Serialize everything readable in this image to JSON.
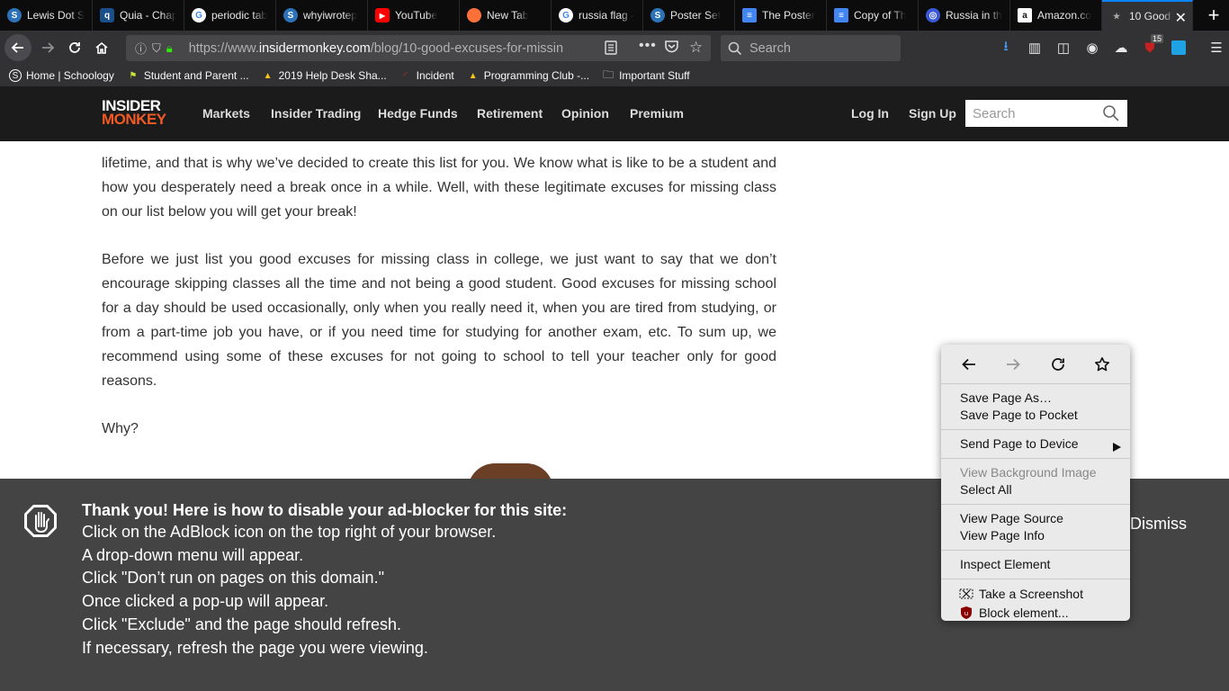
{
  "browser": {
    "tabs": [
      {
        "title": "Lewis Dot S",
        "icon": "schoology-icon",
        "color": "#2b72b9"
      },
      {
        "title": "Quia - Chap",
        "icon": "quia-icon",
        "color": "#1b4f8a"
      },
      {
        "title": "periodic tab",
        "icon": "google-icon",
        "color": "#ffffff"
      },
      {
        "title": "whyiwrotep",
        "icon": "schoology-icon",
        "color": "#2b72b9"
      },
      {
        "title": "YouTube",
        "icon": "youtube-icon",
        "color": "#ff0000"
      },
      {
        "title": "New Tab",
        "icon": "firefox-icon",
        "color": "#ff7139"
      },
      {
        "title": "russia flag -",
        "icon": "google-icon",
        "color": "#ffffff"
      },
      {
        "title": "Poster Set",
        "icon": "schoology-icon",
        "color": "#2b72b9"
      },
      {
        "title": "The Poster",
        "icon": "docs-icon",
        "color": "#4285f4"
      },
      {
        "title": "Copy of Th",
        "icon": "docs-icon",
        "color": "#4285f4"
      },
      {
        "title": "Russia in th",
        "icon": "globe-icon",
        "color": "#3a58d8"
      },
      {
        "title": "Amazon.co",
        "icon": "amazon-icon",
        "color": "#ffffff"
      },
      {
        "title": "10 Good",
        "icon": "insidermonkey-icon",
        "color": "#333333",
        "active": true
      }
    ],
    "new_tab_label": "+",
    "url_prefix": "https://www.",
    "url_domain": "insidermonkey.com",
    "url_path": "/blog/10-good-excuses-for-missin",
    "search_placeholder": "Search",
    "ublock_badge": "15",
    "bookmarks": [
      {
        "label": "Home | Schoology",
        "icon": "schoology-icon"
      },
      {
        "label": "Student and Parent ...",
        "icon": "flag-icon"
      },
      {
        "label": "2019 Help Desk Sha...",
        "icon": "drive-icon"
      },
      {
        "label": "Incident",
        "icon": "incident-icon"
      },
      {
        "label": "Programming Club -...",
        "icon": "drive-icon"
      },
      {
        "label": "Important Stuff",
        "icon": "folder-icon"
      }
    ]
  },
  "site": {
    "logo_top": "INSIDER",
    "logo_bottom": "MONKEY",
    "nav": [
      "Markets",
      "Insider Trading",
      "Hedge Funds",
      "Retirement",
      "Opinion",
      "Premium"
    ],
    "login": "Log In",
    "signup": "Sign Up",
    "search_placeholder": "Search"
  },
  "article": {
    "p1": "lifetime, and that is why we’ve decided to create this list for you. We know what is like to be a student and how you desperately need a break once in a while. Well, with these legitimate excuses for missing class on our list below you will get your break!",
    "p2": "Before we just list you good excuses for missing class in college, we just want to say that we don’t encourage skipping classes all the time and not being a good student. Good excuses for missing school for a day should be used occasionally, only when you really need it, when you are tired from studying, or from a part-time job you have, or if you need time for studying for another exam, etc. To sum up, we recommend using some of these excuses for not going to school to tell your teacher only for good reasons.",
    "p3": "Why?"
  },
  "adblock": {
    "title": "Thank you! Here is how to disable your ad-blocker for this site:",
    "lines": [
      "Click on the AdBlock icon on the top right of your browser.",
      "A drop-down menu will appear.",
      "Click \"Don’t run on pages on this domain.\"",
      "Once clicked a pop-up will appear.",
      "Click \"Exclude\" and the page should refresh.",
      "If necessary, refresh the page you were viewing."
    ],
    "dismiss": "Dismiss"
  },
  "context_menu": {
    "save_page_as": "Save Page As…",
    "save_to_pocket": "Save Page to Pocket",
    "send_to_device": "Send Page to Device",
    "view_bg_image": "View Background Image",
    "select_all": "Select All",
    "view_source": "View Page Source",
    "view_info": "View Page Info",
    "inspect": "Inspect Element",
    "screenshot": "Take a Screenshot",
    "block_element": "Block element..."
  }
}
